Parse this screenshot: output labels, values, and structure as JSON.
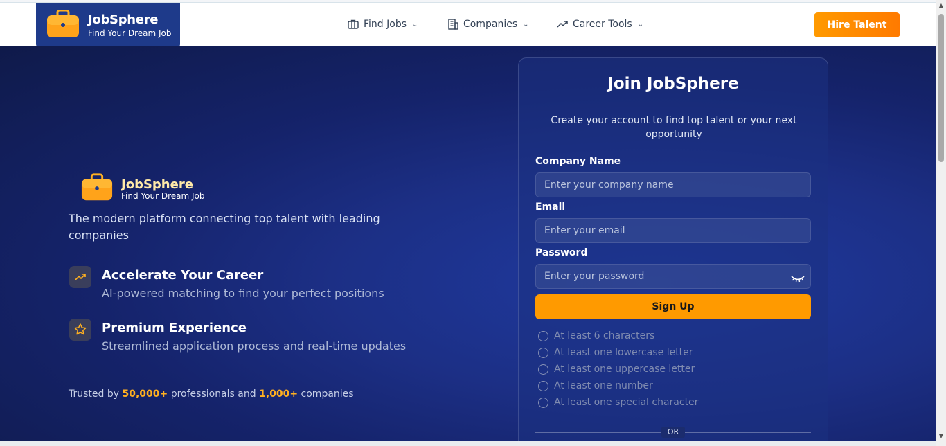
{
  "header": {
    "logo_title": "JobSphere",
    "logo_subtitle": "Find Your Dream Job",
    "nav": [
      {
        "label": "Find Jobs",
        "icon": "briefcase-icon"
      },
      {
        "label": "Companies",
        "icon": "building-icon"
      },
      {
        "label": "Career Tools",
        "icon": "trending-up-icon"
      }
    ],
    "cta": "Hire Talent"
  },
  "hero": {
    "brand_title": "JobSphere",
    "brand_subtitle": "Find Your Dream Job",
    "tagline": "The modern platform connecting top talent with leading companies",
    "features": [
      {
        "title": "Accelerate Your Career",
        "desc": "AI-powered matching to find your perfect positions",
        "icon": "trending-up-icon"
      },
      {
        "title": "Premium Experience",
        "desc": "Streamlined application process and real-time updates",
        "icon": "star-icon"
      }
    ],
    "trusted": {
      "prefix": "Trusted by",
      "pros": "50,000+",
      "middle": "professionals and",
      "companies": "1,000+",
      "suffix": "companies"
    }
  },
  "form": {
    "title": "Join JobSphere",
    "subtitle": "Create your account to find top talent or your next opportunity",
    "company_label": "Company Name",
    "company_placeholder": "Enter your company name",
    "email_label": "Email",
    "email_placeholder": "Enter your email",
    "password_label": "Password",
    "password_placeholder": "Enter your password",
    "submit": "Sign Up",
    "requirements": [
      "At least 6 characters",
      "At least one lowercase letter",
      "At least one uppercase letter",
      "At least one number",
      "At least one special character"
    ],
    "divider": "OR"
  },
  "colors": {
    "accent": "#ff9a00",
    "brand": "#1e3a8a"
  }
}
